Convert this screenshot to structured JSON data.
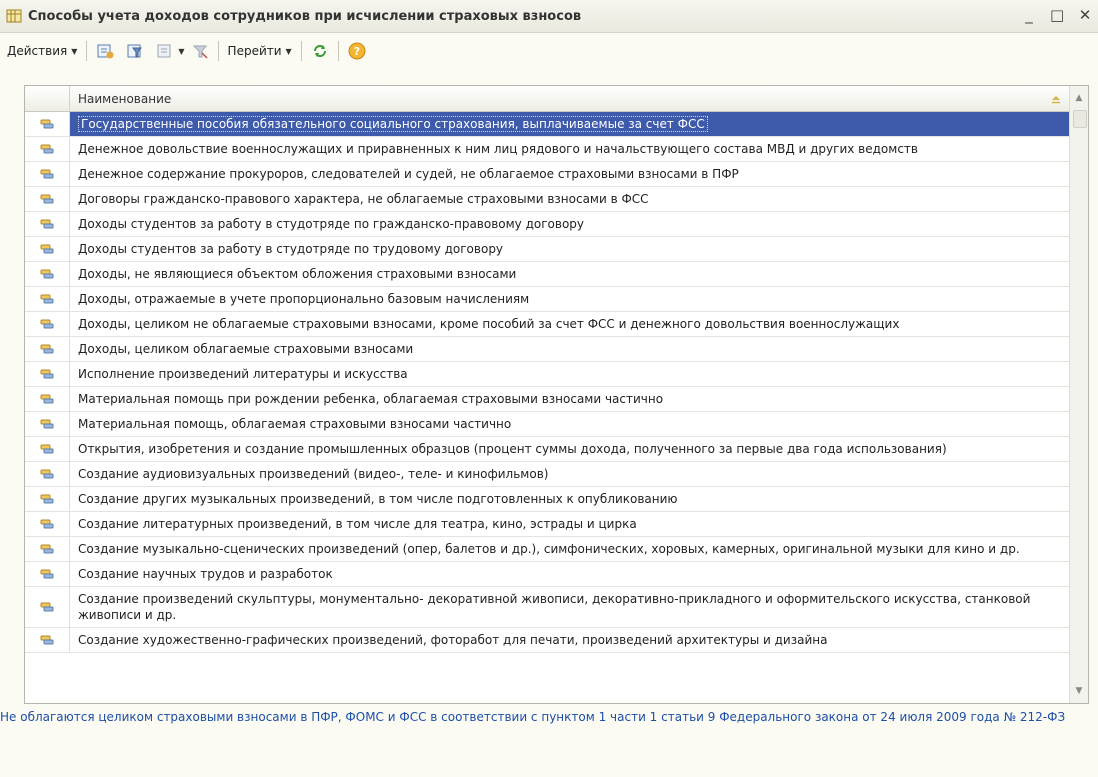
{
  "window": {
    "title": "Способы учета доходов сотрудников при исчислении страховых взносов",
    "minimize": "_",
    "maximize": "□",
    "close": "✕"
  },
  "toolbar": {
    "actions_label": "Действия",
    "goto_label": "Перейти",
    "icons": [
      "add-icon",
      "filter-icon",
      "filter-list-icon",
      "clear-filter-icon",
      "refresh-icon",
      "help-icon"
    ]
  },
  "table": {
    "column_header": "Наименование",
    "rows": [
      {
        "text": "Государственные пособия обязательного социального страхования, выплачиваемые за счет ФСС",
        "selected": true
      },
      {
        "text": "Денежное довольствие военнослужащих и приравненных к ним лиц рядового и начальствующего состава МВД и других ведомств"
      },
      {
        "text": "Денежное содержание прокуроров, следователей и судей, не облагаемое страховыми взносами в ПФР"
      },
      {
        "text": "Договоры гражданско-правового характера, не  облагаемые страховыми взносами в ФСС"
      },
      {
        "text": "Доходы студентов за работу в студотряде по гражданско-правовому договору"
      },
      {
        "text": "Доходы студентов за работу в студотряде по трудовому договору"
      },
      {
        "text": "Доходы, не являющиеся объектом обложения страховыми взносами"
      },
      {
        "text": "Доходы, отражаемые в учете пропорционально базовым начислениям"
      },
      {
        "text": "Доходы, целиком не облагаемые страховыми взносами, кроме пособий за счет ФСС и денежного довольствия военнослужащих"
      },
      {
        "text": "Доходы, целиком облагаемые страховыми взносами"
      },
      {
        "text": "Исполнение произведений литературы и искусства"
      },
      {
        "text": "Материальная помощь при рождении ребенка, облагаемая страховыми взносами частично"
      },
      {
        "text": "Материальная помощь, облагаемая страховыми взносами частично"
      },
      {
        "text": "Открытия, изобретения и создание промышленных образцов (процент суммы дохода, полученного за первые два года использования)"
      },
      {
        "text": "Создание аудиовизуальных произведений (видео-, теле- и кинофильмов)"
      },
      {
        "text": "Создание других музыкальных произведений, в том числе подготовленных к опубликованию"
      },
      {
        "text": "Создание литературных произведений, в том числе для театра, кино, эстрады и цирка"
      },
      {
        "text": "Создание музыкально-сценических произведений (опер, балетов и др.), симфонических, хоровых, камерных, оригинальной музыки для кино и др.",
        "wrap": true
      },
      {
        "text": "Создание научных трудов и разработок"
      },
      {
        "text": "Создание произведений скульптуры, монументально- декоративной живописи, декоративно-прикладного и оформительского искусства, станковой живописи и др.",
        "wrap": true
      },
      {
        "text": "Создание художественно-графических произведений, фоторабот для печати, произведений архитектуры и дизайна"
      }
    ]
  },
  "footer_note": "Не облагаются целиком страховыми взносами в ПФР, ФОМС и ФСС в соответствии с пунктом 1 части 1 статьи 9 Федерального закона от 24 июля 2009 года № 212-ФЗ",
  "colors": {
    "selection": "#3d5aab",
    "footer_text": "#1d4fa6",
    "row_icon": "#e3b54a"
  }
}
